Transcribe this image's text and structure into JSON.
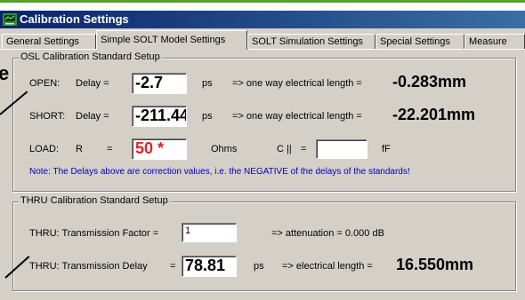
{
  "window": {
    "title": "Calibration Settings"
  },
  "tabs": [
    {
      "label": "General Settings"
    },
    {
      "label": "Simple SOLT Model Settings"
    },
    {
      "label": "SOLT Simulation Settings"
    },
    {
      "label": "Special Settings"
    },
    {
      "label": "Measure"
    }
  ],
  "active_tab": "Simple SOLT Model Settings",
  "edge_text": "e",
  "osl": {
    "title": "OSL Calibration Standard Setup",
    "open": {
      "label": "OPEN:",
      "delay_label": "Delay =",
      "value": "-2.7",
      "unit": "ps",
      "arrow_text": "=>  one way electrical length =",
      "length": "-0.283mm"
    },
    "short": {
      "label": "SHORT:",
      "delay_label": "Delay =",
      "value": "-211.44",
      "unit": "ps",
      "arrow_text": "=>  one way electrical length =",
      "length": "-22.201mm"
    },
    "load": {
      "label": "LOAD:",
      "r_label": "R",
      "eq": "=",
      "value": "50 *",
      "unit": "Ohms",
      "c_label": "C ||",
      "c_eq": "=",
      "c_value": "",
      "c_unit": "fF"
    },
    "note": "Note: The Delays above are correction values, i.e. the NEGATIVE of the delays of the standards!"
  },
  "thru": {
    "title": "THRU Calibration Standard Setup",
    "factor": {
      "label": "THRU: Transmission Factor =",
      "value": "1",
      "result": "=>  attenuation =  0.000 dB"
    },
    "delay": {
      "label": "THRU: Transmission Delay",
      "eq": "=",
      "value": "78.81",
      "unit": "ps",
      "result_label": "=>  electrical length =",
      "result_value": "16.550mm"
    }
  },
  "colors": {
    "titlebar": "#0a246a",
    "note_text": "#0000c0",
    "load_value": "#e02020",
    "accent_line": "#5aa02c"
  }
}
